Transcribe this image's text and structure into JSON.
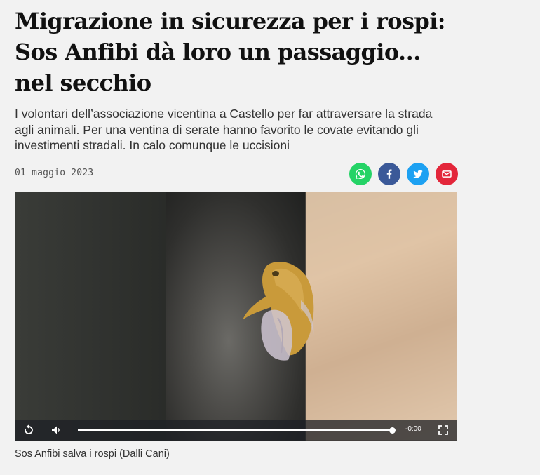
{
  "article": {
    "title": "Migrazione in sicurezza per i rospi: Sos Anfibi dà loro un passaggio... nel secchio",
    "subtitle": "I volontari dell’associazione vicentina a Castello per far attraversare la strada agli animali. Per una ventina di serate hanno favorito le covate evitando gli investimenti stradali. In calo comunque le uccisioni",
    "date": "01 maggio 2023"
  },
  "share": [
    {
      "icon": "whatsapp-icon",
      "color": "#25d366"
    },
    {
      "icon": "facebook-icon",
      "color": "#3b5998"
    },
    {
      "icon": "twitter-icon",
      "color": "#1da1f2"
    },
    {
      "icon": "email-icon",
      "color": "#e3263a"
    }
  ],
  "video": {
    "time_remaining": "-0:00",
    "progress": 1.0,
    "caption": "Sos Anfibi salva i rospi (Dalli Cani)"
  }
}
